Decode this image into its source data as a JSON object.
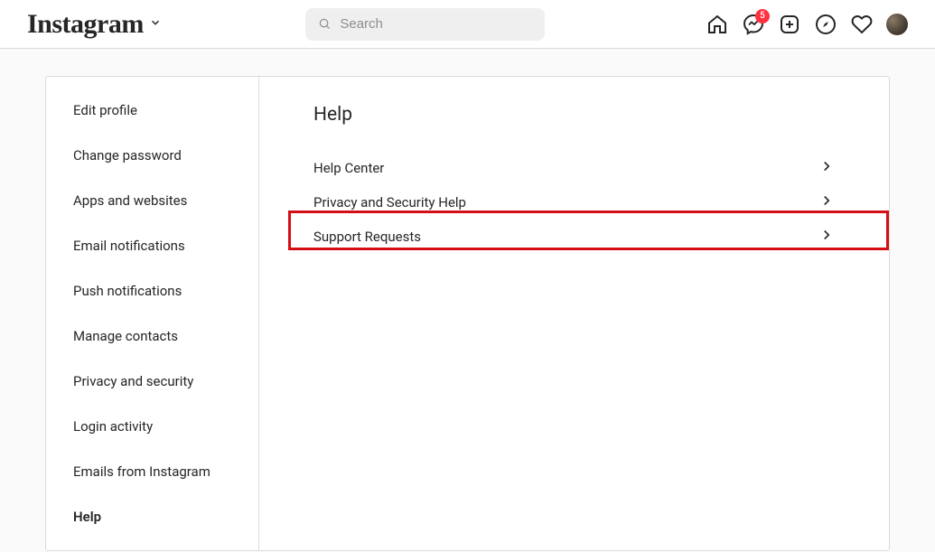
{
  "header": {
    "brand": "Instagram",
    "search_placeholder": "Search",
    "messenger_badge": "5"
  },
  "sidebar": {
    "items": [
      {
        "label": "Edit profile"
      },
      {
        "label": "Change password"
      },
      {
        "label": "Apps and websites"
      },
      {
        "label": "Email notifications"
      },
      {
        "label": "Push notifications"
      },
      {
        "label": "Manage contacts"
      },
      {
        "label": "Privacy and security"
      },
      {
        "label": "Login activity"
      },
      {
        "label": "Emails from Instagram"
      },
      {
        "label": "Help",
        "active": true
      }
    ]
  },
  "main": {
    "title": "Help",
    "options": [
      {
        "label": "Help Center"
      },
      {
        "label": "Privacy and Security Help"
      },
      {
        "label": "Support Requests",
        "highlighted": true
      }
    ]
  }
}
